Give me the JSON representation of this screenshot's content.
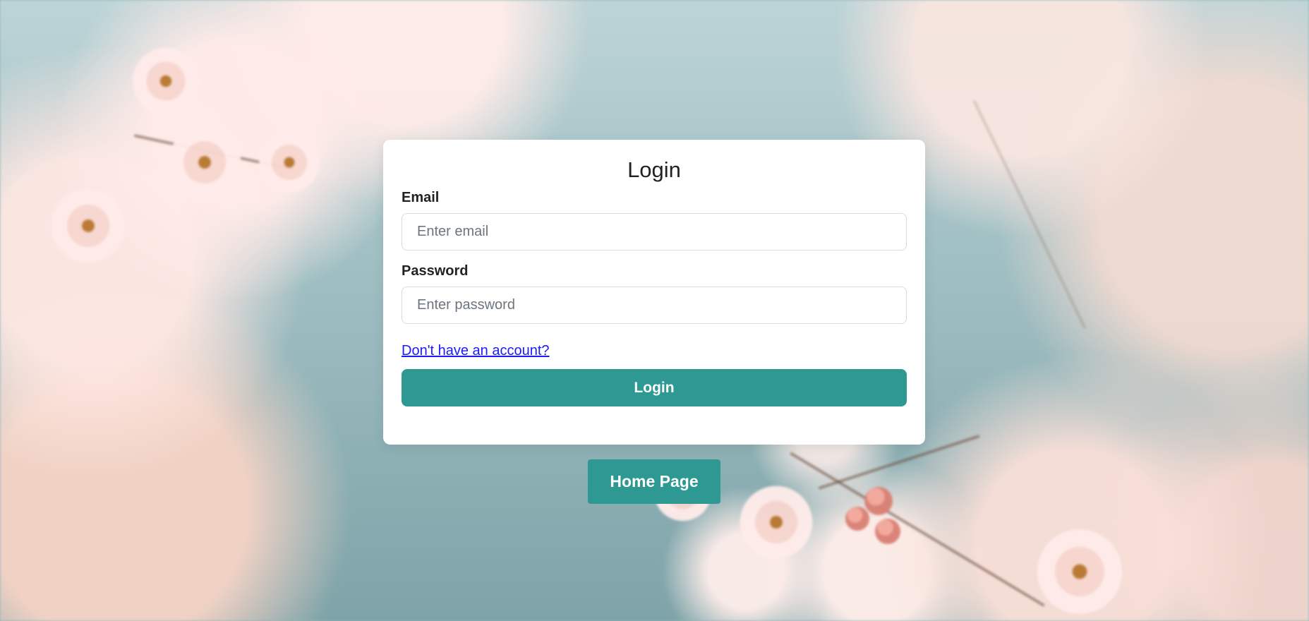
{
  "login_form": {
    "title": "Login",
    "email_label": "Email",
    "email_placeholder": "Enter email",
    "password_label": "Password",
    "password_placeholder": "Enter password",
    "signup_link": "Don't have an account?",
    "submit_label": "Login"
  },
  "navigation": {
    "home_button_label": "Home Page"
  },
  "colors": {
    "accent": "#2e9893",
    "link": "#1a1aff",
    "card_background": "#ffffff"
  }
}
